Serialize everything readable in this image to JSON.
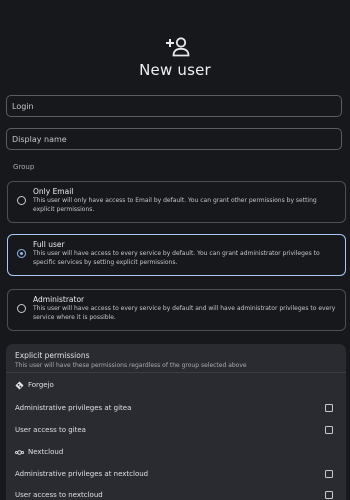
{
  "header": {
    "icon": "add-user-icon",
    "title": "New user"
  },
  "form": {
    "login_placeholder": "Login",
    "display_name_placeholder": "Display name"
  },
  "group": {
    "label": "Group",
    "selected": "Full user",
    "options": [
      {
        "title": "Only Email",
        "description": "This user will only have access to Email by default. You can grant other permissions by setting explicit permissions.",
        "selected": false
      },
      {
        "title": "Full user",
        "description": "This user will have access to every service by default. You can grant administrator privileges to specific services by setting explicit permissions.",
        "selected": true
      },
      {
        "title": "Administrator",
        "description": "This user will have access to every service by default and will have administrator privileges to every service where it is possible.",
        "selected": false
      }
    ]
  },
  "permissions": {
    "title": "Explicit permissions",
    "description": "This user will have these permissions regardless of the group selected above",
    "services": [
      {
        "name": "Forgejo",
        "icon": "forgejo-icon",
        "items": [
          {
            "label": "Administrative privileges at gitea",
            "checked": false
          },
          {
            "label": "User access to gitea",
            "checked": false
          }
        ]
      },
      {
        "name": "Nextcloud",
        "icon": "nextcloud-icon",
        "items": [
          {
            "label": "Administrative privileges at nextcloud",
            "checked": false
          },
          {
            "label": "User access to nextcloud",
            "checked": false
          }
        ]
      }
    ]
  },
  "colors": {
    "background": "#17181c",
    "panel": "#2a2b30",
    "accent": "#a9c8f5",
    "border": "#4c4e56"
  }
}
